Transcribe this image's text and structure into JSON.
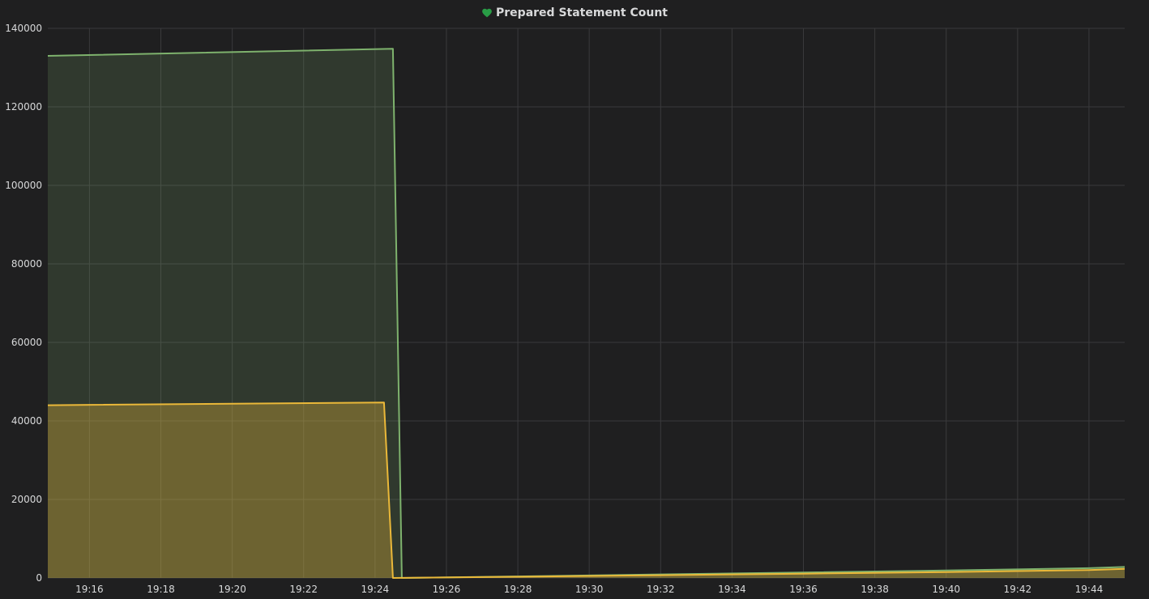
{
  "panel": {
    "title": "Prepared Statement Count",
    "status_icon": "heart-icon",
    "status_color": "#299c46"
  },
  "chart_data": {
    "type": "area",
    "title": "Prepared Statement Count",
    "xlabel": "",
    "ylabel": "",
    "ylim": [
      0,
      140000
    ],
    "yticks": [
      0,
      20000,
      40000,
      60000,
      80000,
      100000,
      120000,
      140000
    ],
    "ytick_labels": [
      "0",
      "20000",
      "40000",
      "60000",
      "80000",
      "100000",
      "120000",
      "140000"
    ],
    "x_range": [
      "19:14:50",
      "19:45:00"
    ],
    "xticks": [
      "19:16",
      "19:18",
      "19:20",
      "19:22",
      "19:24",
      "19:26",
      "19:28",
      "19:30",
      "19:32",
      "19:34",
      "19:36",
      "19:38",
      "19:40",
      "19:42",
      "19:44"
    ],
    "grid": true,
    "legend": "none",
    "series": [
      {
        "color": "#7eb26d",
        "x": [
          "19:14:50",
          "19:24:30",
          "19:24:45",
          "19:28:00",
          "19:32:00",
          "19:36:00",
          "19:40:00",
          "19:44:00",
          "19:45:00"
        ],
        "values": [
          133000,
          134800,
          0,
          400,
          900,
          1400,
          1900,
          2500,
          2800
        ]
      },
      {
        "color": "#eab839",
        "x": [
          "19:14:50",
          "19:24:15",
          "19:24:30",
          "19:28:00",
          "19:32:00",
          "19:36:00",
          "19:40:00",
          "19:44:00",
          "19:45:00"
        ],
        "values": [
          44000,
          44700,
          0,
          300,
          700,
          1100,
          1500,
          2000,
          2300
        ]
      }
    ]
  }
}
